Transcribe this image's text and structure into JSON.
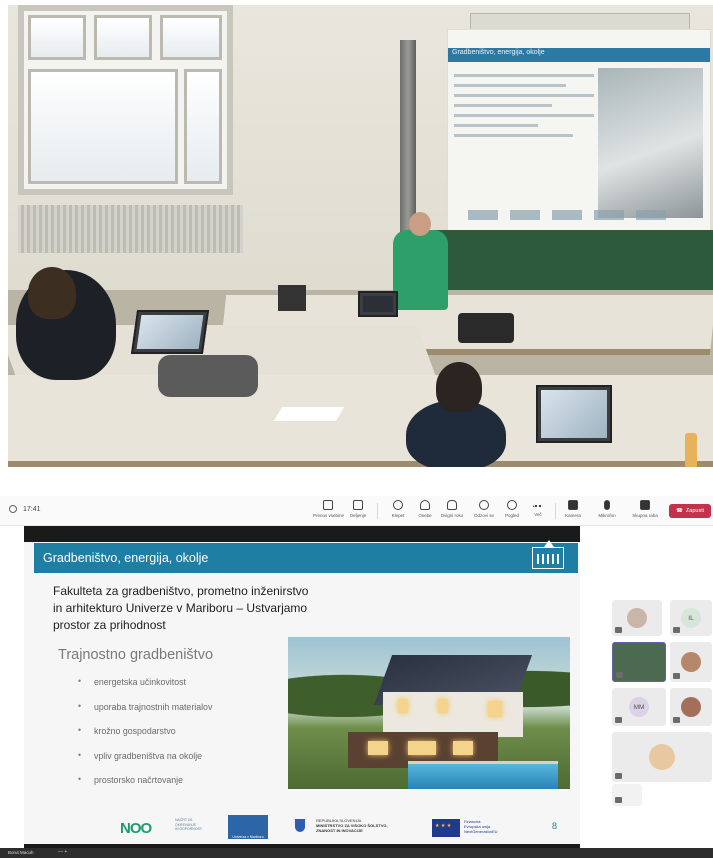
{
  "photo": {
    "projector_slide_title": "Gradbeništvo, energija, okolje"
  },
  "toolbar": {
    "time": "17:41",
    "items": [
      {
        "id": "share",
        "label": "Prenos vsebine",
        "icon": "share-screen-icon"
      },
      {
        "id": "shareapp",
        "label": "Deljenje",
        "icon": "share-tray-icon"
      },
      {
        "id": "chat",
        "label": "Klepet",
        "icon": "chat-icon"
      },
      {
        "id": "people",
        "label": "Osebe",
        "icon": "people-icon"
      },
      {
        "id": "raise",
        "label": "Dvigni roko",
        "icon": "raise-hand-icon"
      },
      {
        "id": "react",
        "label": "Odzovi se",
        "icon": "reaction-icon"
      },
      {
        "id": "view",
        "label": "Pogled",
        "icon": "view-grid-icon"
      },
      {
        "id": "more",
        "label": "Več",
        "icon": "more-icon"
      },
      {
        "id": "camera",
        "label": "Kamera",
        "icon": "camera-icon"
      },
      {
        "id": "mic",
        "label": "Mikrofon",
        "icon": "microphone-icon"
      },
      {
        "id": "sharecontent",
        "label": "Skupna raba",
        "icon": "share-up-icon"
      }
    ],
    "leave_label": "Zapusti"
  },
  "slide": {
    "header_title": "Gradbeništvo, energija, okolje",
    "heading_lines": [
      "Fakulteta za gradbeništvo, prometno inženirstvo",
      "in arhitekturo Univerze v Mariboru – Ustvarjamo",
      "prostor za prihodnost"
    ],
    "subheading": "Trajnostno gradbeništvo",
    "bullets": [
      "energetska učinkovitost",
      "uporaba trajnostnih materialov",
      "krožno gospodarstvo",
      "vpliv gradbeništva na okolje",
      "prostorsko načrtovanje"
    ],
    "footer": {
      "noo_logo": "NOO",
      "noo_sub": [
        "NAČRT ZA",
        "OKREVANJE",
        "IN ODPORNOST"
      ],
      "um_label": "Univerza v Mariboru",
      "ministry_lines": [
        "REPUBLIKA SLOVENIJA",
        "MINISTRSTVO ZA VISOKO ŠOLSTVO,",
        "ZNANOST IN INOVACIJE"
      ],
      "eu_lines": [
        "Financira",
        "Evropska unija",
        "NextGenerationEU"
      ],
      "page_number": "8"
    }
  },
  "participants": [
    {
      "initials": "",
      "kind": "photo"
    },
    {
      "initials": "IL",
      "kind": "initials"
    },
    {
      "initials": "",
      "kind": "video"
    },
    {
      "initials": "",
      "kind": "photo"
    },
    {
      "initials": "MM",
      "kind": "initials"
    },
    {
      "initials": "",
      "kind": "photo"
    },
    {
      "initials": "",
      "kind": "photo"
    },
    {
      "initials": "",
      "kind": "empty"
    }
  ],
  "bottom_bar": {
    "presenter_name": "Borut Macuh",
    "controls": "—  +"
  },
  "colors": {
    "slide_header": "#1f7ea4",
    "leave_button": "#c4314b",
    "teams_accent": "#6264a7",
    "noo_green": "#1c9c6d"
  }
}
